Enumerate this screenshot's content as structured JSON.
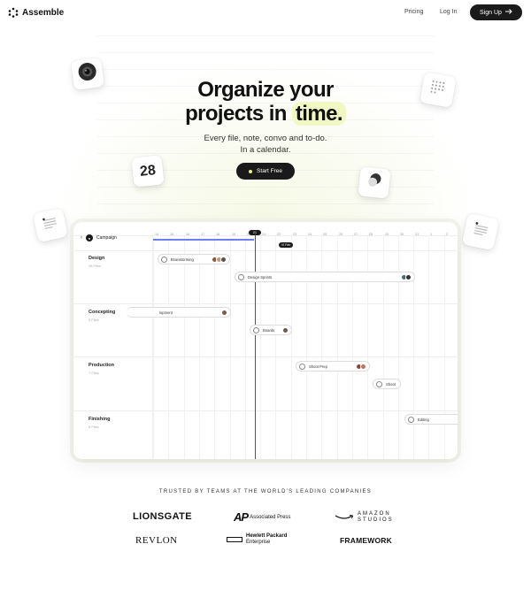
{
  "nav": {
    "logo_text": "Assemble",
    "links": [
      "Pricing",
      "Log In"
    ],
    "signup_label": "Sign Up",
    "signup_icon": "arrow-right-icon"
  },
  "hero": {
    "title_line1": "Organize your",
    "title_line2_prefix": "projects in",
    "title_highlight": "time.",
    "subtitle_line1": "Every file, note, convo and to-do.",
    "subtitle_line2": "In a calendar.",
    "cta_label": "Start Free",
    "highlight_color": "#f2f8c4",
    "cta_dot_color": "#e8f27a"
  },
  "floating": {
    "calendar_date": "28"
  },
  "app": {
    "campaign_label": "Campaign",
    "dates": [
      "14",
      "15",
      "16",
      "17",
      "18",
      "19",
      "20",
      "21",
      "22",
      "23",
      "24",
      "25",
      "26",
      "27",
      "28",
      "29",
      "30",
      "31",
      "1",
      "2"
    ],
    "today_label": "21",
    "now_tag": "VI Feb",
    "stages": [
      {
        "name": "Design",
        "files": "18 Files"
      },
      {
        "name": "Concepting",
        "files": "5 Files"
      },
      {
        "name": "Production",
        "files": "7 Files"
      },
      {
        "name": "Finishing",
        "files": "5 Files"
      }
    ],
    "tasks": [
      {
        "label": "Brainstorming"
      },
      {
        "label": "Design Sprints"
      },
      {
        "label": "lopment"
      },
      {
        "label": "Boards"
      },
      {
        "label": "Shoot Prep"
      },
      {
        "label": "Shoot"
      },
      {
        "label": "Editing"
      }
    ]
  },
  "trusted": {
    "heading": "TRUSTED BY TEAMS AT THE WORLD'S LEADING COMPANIES",
    "logos": {
      "lionsgate": "LIONSGATE",
      "ap_mark": "AP",
      "ap_text": "Associated Press",
      "amazon_line1": "AMAZON",
      "amazon_line2": "STUDIOS",
      "revlon": "REVLON",
      "hpe_line1": "Hewlett Packard",
      "hpe_line2": "Enterprise",
      "framework": "FRAMEWORK"
    }
  }
}
